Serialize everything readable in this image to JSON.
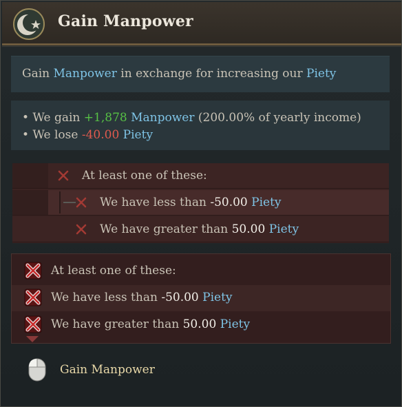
{
  "header": {
    "title": "Gain Manpower",
    "emblem_icon": "crescent-star-icon"
  },
  "description": {
    "prefix": "Gain ",
    "term1": "Manpower",
    "middle": " in exchange for increasing our ",
    "term2": "Piety"
  },
  "effects": [
    {
      "bullet": "• We gain ",
      "amount": "+1,878",
      "resource": "Manpower",
      "suffix": " (200.00% of yearly income)"
    },
    {
      "bullet": "• We lose ",
      "amount": "-40.00",
      "resource": "Piety",
      "suffix": ""
    }
  ],
  "requirements_collapsed": {
    "header": "At least one of these:",
    "rows": [
      {
        "prefix": "We have less than ",
        "value": "-50.00",
        "resource": "Piety"
      },
      {
        "prefix": "We have greater than ",
        "value": "50.00",
        "resource": "Piety"
      }
    ],
    "icon": "cross-icon"
  },
  "requirements_expanded": {
    "header": "At least one of these:",
    "rows": [
      {
        "prefix": "We have less than ",
        "value": "-50.00",
        "resource": "Piety"
      },
      {
        "prefix": "We have greater than ",
        "value": "50.00",
        "resource": "Piety"
      }
    ],
    "icon": "cross-box-icon"
  },
  "action_hint": {
    "icon": "left-mouse-icon",
    "label": "Gain Manpower"
  },
  "colors": {
    "highlight": "#7fc4e6",
    "positive": "#57c145",
    "negative": "#e05a4e",
    "header_border": "#6e5b3e"
  }
}
